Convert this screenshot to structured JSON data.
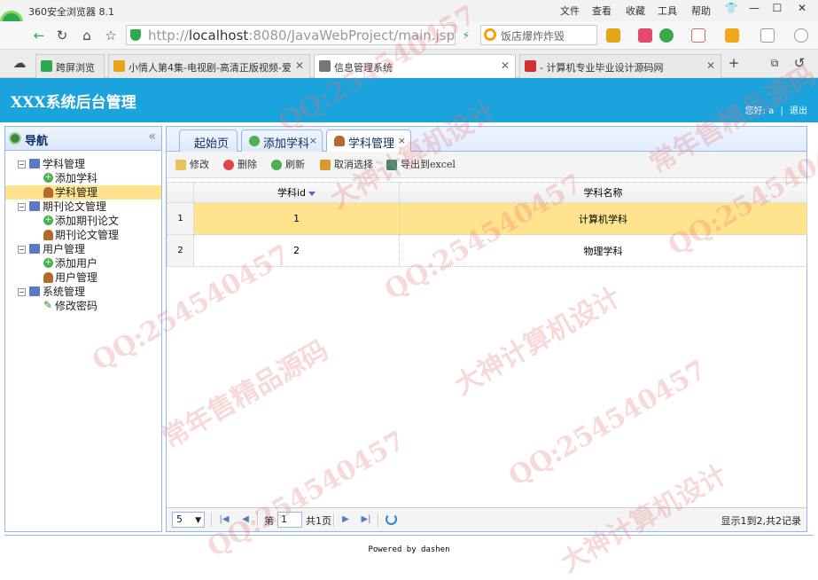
{
  "browser": {
    "title": "360安全浏览器 8.1",
    "menu": [
      "文件",
      "查看",
      "收藏",
      "工具",
      "帮助"
    ],
    "address": {
      "prefix": "http://",
      "host": "localhost",
      "rest": ":8080/JavaWebProject/main.jsp"
    },
    "search_placeholder": "饭店爆炸炸毁",
    "tabs": [
      {
        "label": "跨屏浏览",
        "color": "#2fa84f"
      },
      {
        "label": "小情人第4集-电视剧-高清正版视频-爱",
        "color": "#e8a317"
      },
      {
        "label": "信息管理系统",
        "color": "#777777",
        "active": true
      },
      {
        "label": "- 计算机专业毕业设计源码网",
        "color": "#d32f2f"
      }
    ]
  },
  "app": {
    "title": "XXX系统后台管理",
    "user_greeting": "您好: a",
    "logout": "退出",
    "header_color": "#1aa3dc"
  },
  "sidebar": {
    "title": "导航",
    "groups": [
      {
        "label": "学科管理",
        "children": [
          {
            "label": "添加学科",
            "icon": "add-icon"
          },
          {
            "label": "学科管理",
            "icon": "user-icon",
            "selected": true
          }
        ]
      },
      {
        "label": "期刊论文管理",
        "children": [
          {
            "label": "添加期刊论文",
            "icon": "add-icon"
          },
          {
            "label": "期刊论文管理",
            "icon": "user-icon"
          }
        ]
      },
      {
        "label": "用户管理",
        "children": [
          {
            "label": "添加用户",
            "icon": "add-icon"
          },
          {
            "label": "用户管理",
            "icon": "user-icon"
          }
        ]
      },
      {
        "label": "系统管理",
        "children": [
          {
            "label": "修改密码",
            "icon": "pencil-icon"
          }
        ]
      }
    ]
  },
  "tabs": [
    {
      "label": "起始页"
    },
    {
      "label": "添加学科",
      "closable": "×"
    },
    {
      "label": "学科管理",
      "closable": "×",
      "active": true
    }
  ],
  "toolbar": {
    "edit": "修改",
    "delete": "删除",
    "refresh": "刷新",
    "deselect": "取消选择",
    "export": "导出到excel"
  },
  "grid": {
    "columns": [
      "学科id",
      "学科名称"
    ],
    "rows": [
      {
        "num": "1",
        "id": "1",
        "name": "计算机学科",
        "selected": true
      },
      {
        "num": "2",
        "id": "2",
        "name": "物理学科"
      }
    ]
  },
  "pager": {
    "page_size": "5",
    "page_label": "第",
    "page_value": "1",
    "total_pages": "共1页",
    "info": "显示1到2,共2记录"
  },
  "footer": {
    "powered": "Powered by dashen"
  },
  "watermarks": [
    "QQ:254540457",
    "大神计算机设计",
    "常年售精品源码"
  ]
}
